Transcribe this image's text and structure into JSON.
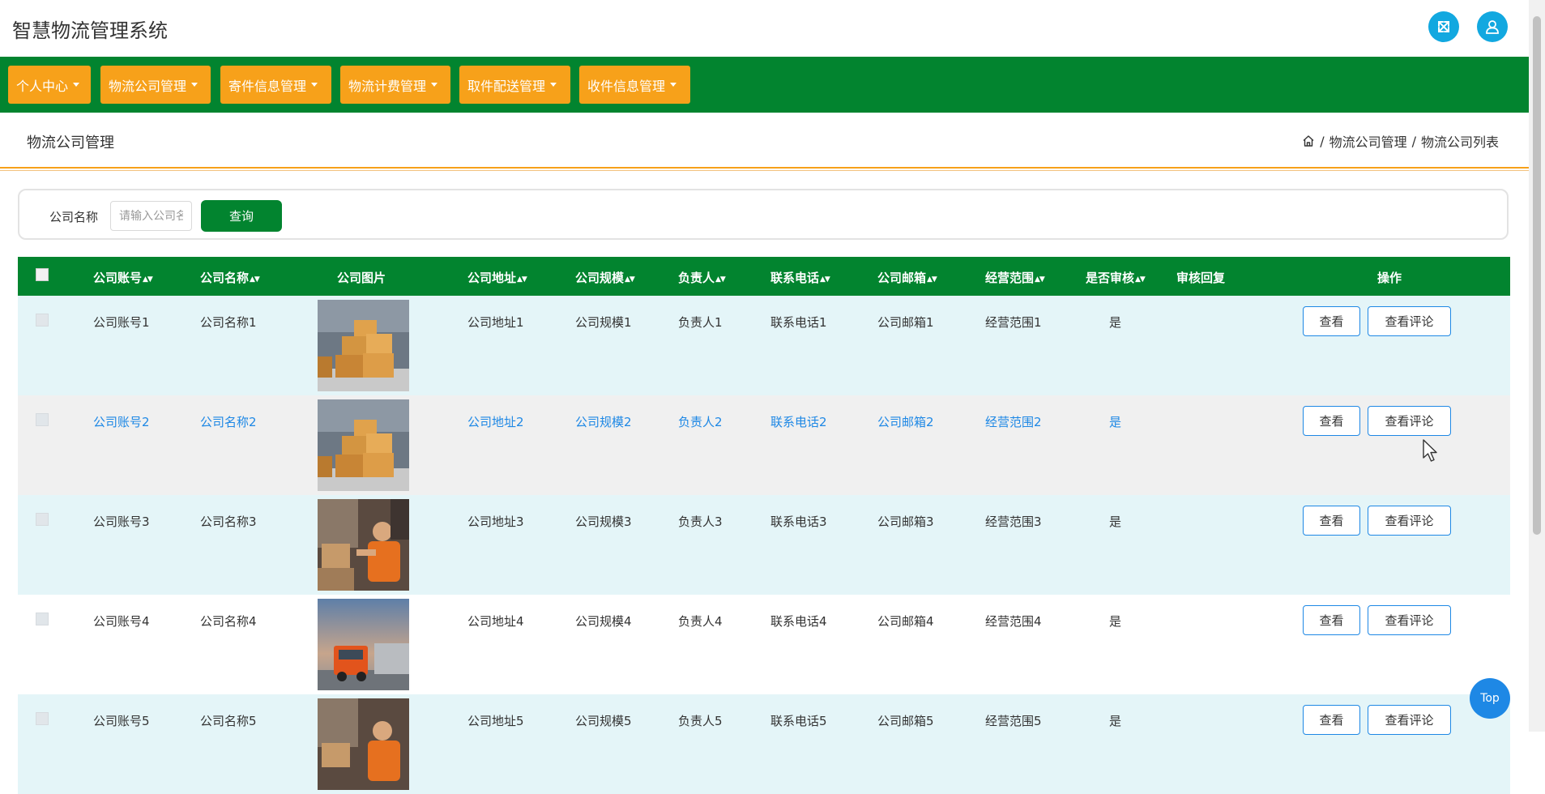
{
  "app": {
    "title": "智慧物流管理系统"
  },
  "header": {
    "fullscreen_icon": "expand-icon",
    "user_icon": "user-icon"
  },
  "nav": {
    "items": [
      {
        "label": "个人中心"
      },
      {
        "label": "物流公司管理"
      },
      {
        "label": "寄件信息管理"
      },
      {
        "label": "物流计费管理"
      },
      {
        "label": "取件配送管理"
      },
      {
        "label": "收件信息管理"
      }
    ],
    "color": "#02842f",
    "item_color": "#f7a11a"
  },
  "page": {
    "title": "物流公司管理",
    "breadcrumb": {
      "home_icon": "home-icon",
      "sep": "/",
      "level1": "物流公司管理",
      "level2": "物流公司列表"
    }
  },
  "search": {
    "label": "公司名称",
    "placeholder": "请输入公司名称",
    "value": "",
    "button": "查询"
  },
  "table": {
    "headers": {
      "account": "公司账号",
      "name": "公司名称",
      "image": "公司图片",
      "address": "公司地址",
      "scale": "公司规模",
      "manager": "负责人",
      "phone": "联系电话",
      "email": "公司邮箱",
      "scope": "经营范围",
      "audited": "是否审核",
      "reply": "审核回复",
      "actions": "操作"
    },
    "rows": [
      {
        "account": "公司账号1",
        "name": "公司名称1",
        "image": "warehouse-boxes",
        "address": "公司地址1",
        "scale": "公司规模1",
        "manager": "负责人1",
        "phone": "联系电话1",
        "email": "公司邮箱1",
        "scope": "经营范围1",
        "audited": "是",
        "reply": ""
      },
      {
        "account": "公司账号2",
        "name": "公司名称2",
        "image": "warehouse-boxes",
        "address": "公司地址2",
        "scale": "公司规模2",
        "manager": "负责人2",
        "phone": "联系电话2",
        "email": "公司邮箱2",
        "scope": "经营范围2",
        "audited": "是",
        "reply": ""
      },
      {
        "account": "公司账号3",
        "name": "公司名称3",
        "image": "courier-worker",
        "address": "公司地址3",
        "scale": "公司规模3",
        "manager": "负责人3",
        "phone": "联系电话3",
        "email": "公司邮箱3",
        "scope": "经营范围3",
        "audited": "是",
        "reply": ""
      },
      {
        "account": "公司账号4",
        "name": "公司名称4",
        "image": "delivery-truck",
        "address": "公司地址4",
        "scale": "公司规模4",
        "manager": "负责人4",
        "phone": "联系电话4",
        "email": "公司邮箱4",
        "scope": "经营范围4",
        "audited": "是",
        "reply": ""
      },
      {
        "account": "公司账号5",
        "name": "公司名称5",
        "image": "courier-worker",
        "address": "公司地址5",
        "scale": "公司规模5",
        "manager": "负责人5",
        "phone": "联系电话5",
        "email": "公司邮箱5",
        "scope": "经营范围5",
        "audited": "是",
        "reply": ""
      }
    ],
    "view_label": "查看",
    "comment_label": "查看评论"
  },
  "top_button": "Top"
}
